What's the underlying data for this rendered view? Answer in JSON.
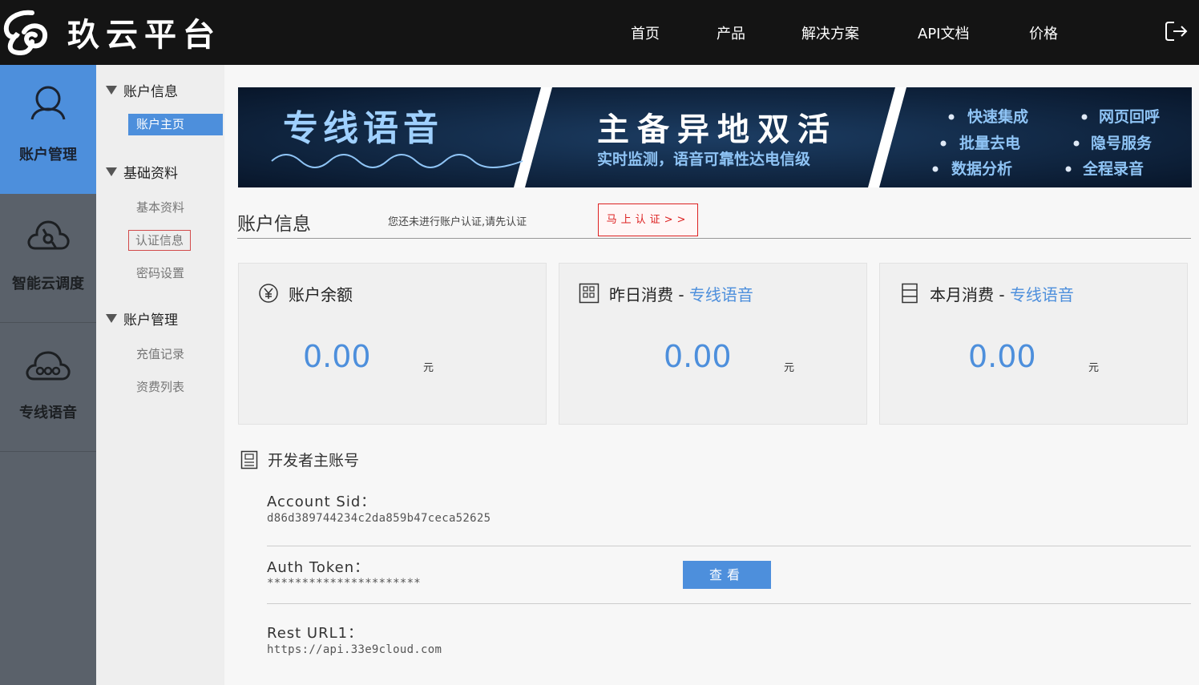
{
  "header": {
    "logo_text": "玖云平台",
    "nav": [
      "首页",
      "产品",
      "解决方案",
      "API文档",
      "价格"
    ]
  },
  "sidebar": {
    "items": [
      {
        "label": "账户管理",
        "icon": "user-icon"
      },
      {
        "label": "智能云调度",
        "icon": "cloud-network-icon"
      },
      {
        "label": "专线语音",
        "icon": "cloud-voice-icon"
      }
    ]
  },
  "submenu": {
    "groups": [
      {
        "label": "账户信息",
        "items": [
          "账户主页"
        ]
      },
      {
        "label": "基础资料",
        "items": [
          "基本资料",
          "认证信息",
          "密码设置"
        ]
      },
      {
        "label": "账户管理",
        "items": [
          "充值记录",
          "资费列表"
        ]
      }
    ]
  },
  "banner": {
    "title": "专线语音",
    "headline": "主备异地双活",
    "subline": "实时监测，语音可靠性达电信级",
    "features": [
      "快速集成",
      "批量去电",
      "数据分析",
      "网页回呼",
      "隐号服务",
      "全程录音"
    ]
  },
  "account_info": {
    "title": "账户信息",
    "note": "您还未进行账户认证,请先认证",
    "verify_button": "马上认证>>"
  },
  "cards": [
    {
      "title": "账户余额",
      "highlight": "",
      "value": "0.00",
      "unit": "元",
      "icon": "yen-icon"
    },
    {
      "title": "昨日消费",
      "highlight": "专线语音",
      "value": "0.00",
      "unit": "元",
      "icon": "grid-icon"
    },
    {
      "title": "本月消费",
      "highlight": "专线语音",
      "value": "0.00",
      "unit": "元",
      "icon": "list-icon"
    }
  ],
  "developer": {
    "title": "开发者主账号",
    "account_sid_label": "Account Sid：",
    "account_sid": "d86d389744234c2da859b47ceca52625",
    "auth_token_label": "Auth Token：",
    "auth_token": "**********************",
    "view_button": "查看",
    "rest_url_label": "Rest URL1：",
    "rest_url": "https://api.33e9cloud.com"
  },
  "colors": {
    "accent": "#4d8fdc",
    "topbar": "#141414",
    "sidebar": "#5a616a",
    "alert": "#dd2222"
  }
}
